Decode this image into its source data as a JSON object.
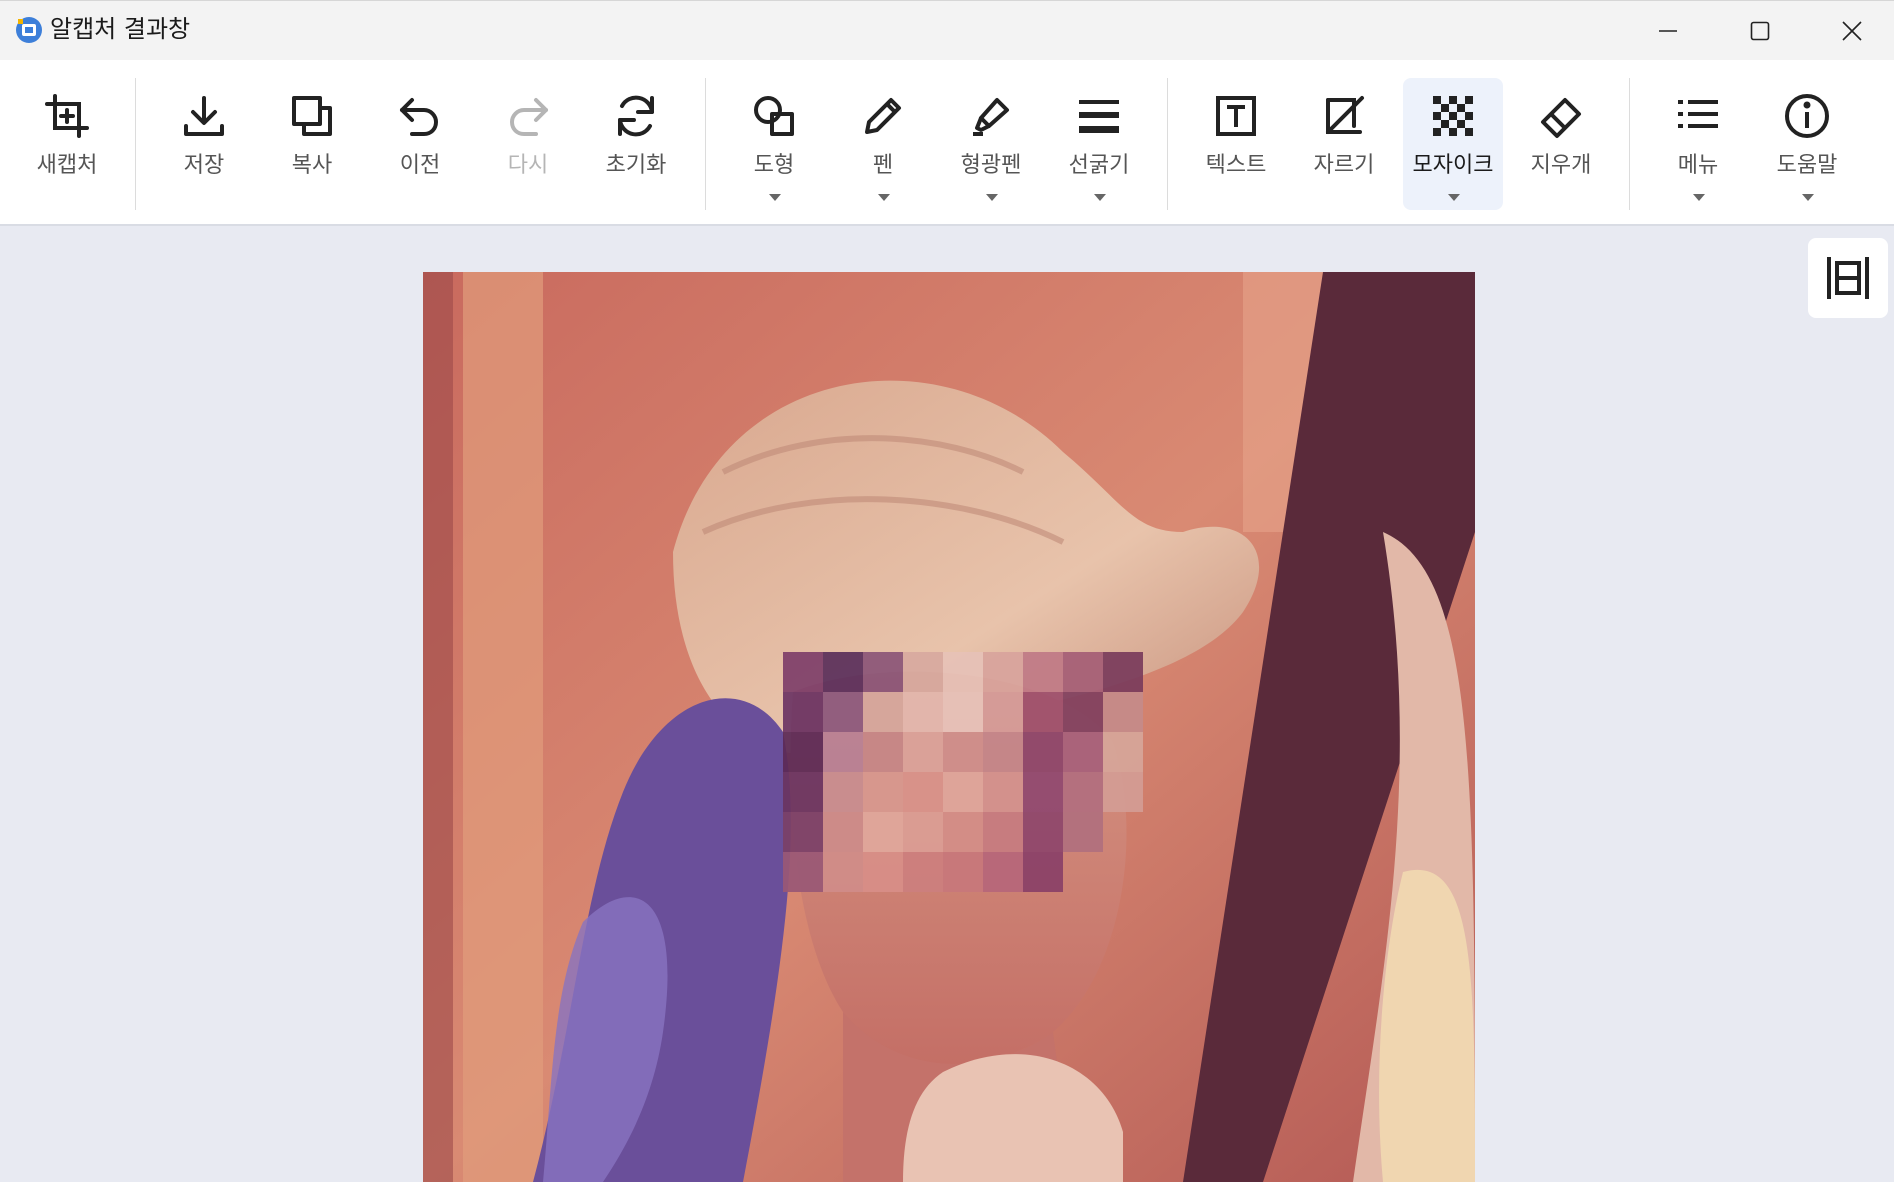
{
  "window": {
    "title": "알캡처 결과창",
    "controls": [
      "minimize-icon",
      "maximize-icon",
      "close-icon"
    ]
  },
  "toolbar": {
    "tools": [
      {
        "id": "new-capture",
        "label": "새캡처",
        "icon": "crop-plus-icon"
      },
      {
        "id": "save",
        "label": "저장",
        "icon": "download-icon"
      },
      {
        "id": "copy",
        "label": "복사",
        "icon": "copy-icon"
      },
      {
        "id": "undo",
        "label": "이전",
        "icon": "undo-icon"
      },
      {
        "id": "redo",
        "label": "다시",
        "icon": "redo-icon",
        "disabled": true
      },
      {
        "id": "reset",
        "label": "초기화",
        "icon": "refresh-icon"
      },
      {
        "id": "shape",
        "label": "도형",
        "icon": "shapes-icon",
        "dropdown": true
      },
      {
        "id": "pen",
        "label": "펜",
        "icon": "pen-icon",
        "dropdown": true
      },
      {
        "id": "highlighter",
        "label": "형광펜",
        "icon": "highlighter-icon",
        "dropdown": true
      },
      {
        "id": "line-width",
        "label": "선굵기",
        "icon": "line-weight-icon",
        "dropdown": true
      },
      {
        "id": "text",
        "label": "텍스트",
        "icon": "text-box-icon"
      },
      {
        "id": "crop",
        "label": "자르기",
        "icon": "crop-icon"
      },
      {
        "id": "mosaic",
        "label": "모자이크",
        "icon": "mosaic-icon",
        "dropdown": true,
        "active": true
      },
      {
        "id": "eraser",
        "label": "지우개",
        "icon": "eraser-icon"
      },
      {
        "id": "menu",
        "label": "메뉴",
        "icon": "list-icon",
        "dropdown": true
      },
      {
        "id": "help",
        "label": "도움말",
        "icon": "info-icon",
        "dropdown": true
      }
    ]
  },
  "canvas": {
    "side_button_icon": "fit-height-icon",
    "image": "captured-photo-with-mosaic"
  },
  "colors": {
    "icon": "#222222",
    "active_bg": "#edf2fb",
    "canvas_bg": "#e8eaf2"
  }
}
